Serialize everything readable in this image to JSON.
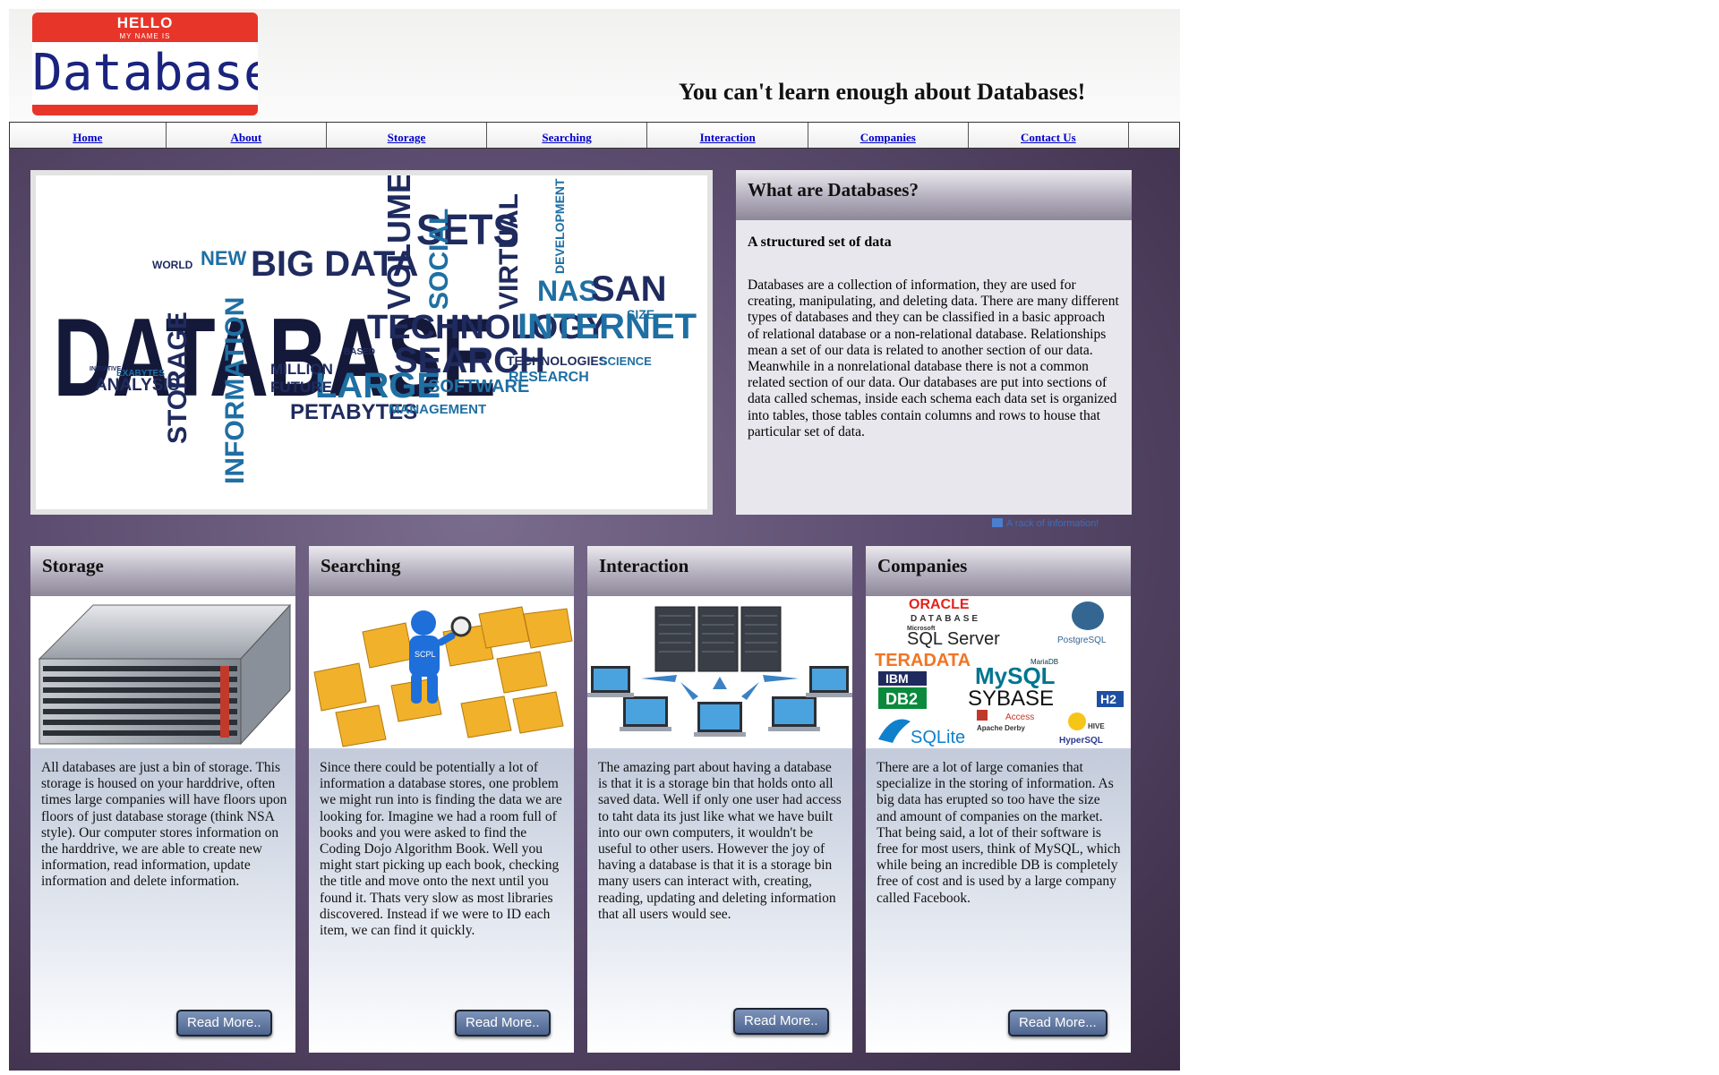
{
  "header": {
    "logo": {
      "hello": "HELLO",
      "my_name_is": "MY NAME IS",
      "name": "Database"
    },
    "tagline": "You can't learn enough about Databases!"
  },
  "nav": {
    "items": [
      {
        "label": "Home"
      },
      {
        "label": "About"
      },
      {
        "label": "Storage"
      },
      {
        "label": "Searching"
      },
      {
        "label": "Interaction"
      },
      {
        "label": "Companies"
      },
      {
        "label": "Contact Us"
      }
    ]
  },
  "hero": {
    "wordcloud": {
      "big": "DATABASE",
      "words": [
        "SETS",
        "BIG DATA",
        "VOLUME",
        "SOCIAL",
        "VIRTUAL",
        "NAS",
        "SAN",
        "NEW",
        "WORLD",
        "TECHNOLOGY",
        "INTERNET",
        "SEARCH",
        "LARGE",
        "MILLION",
        "FUTURE",
        "SOFTWARE",
        "PETABYTES",
        "MANAGEMENT",
        "ANALYSIS",
        "STORAGE",
        "INFORMATION",
        "RESEARCH",
        "TECHNOLOGIES",
        "SCIENCE",
        "EXABYTES",
        "INITIATIVE",
        "SIZE",
        "DEVELOPMENT",
        "BASED"
      ]
    }
  },
  "whatis": {
    "title": "What are Databases?",
    "subtitle": "A structured set of data",
    "body": "Databases are a collection of information, they are used for creating, manipulating, and deleting data. There are many different types of databases and they can be classified in a basic approach of relational database or a non-relational database. Relationships mean a set of our data is related to another section of our data. Meanwhile in a nonrelational database there is not a common related section of our data. Our databases are put into sections of data called schemas, inside each schema each data set is organized into tables, those tables contain columns and rows to house that particular set of data."
  },
  "credit": "A rack of information!",
  "cards": [
    {
      "title": "Storage",
      "text": "All databases are just a bin of storage. This storage is housed on your harddrive, often times large companies will have floors upon floors of just database storage (think NSA style). Our computer stores information on the harddrive, we are able to create new information, read information, update information and delete information.",
      "button": "Read More.."
    },
    {
      "title": "Searching",
      "text": "Since there could be potentially a lot of information a database stores, one problem we might run into is finding the data we are looking for. Imagine we had a room full of books and you were asked to find the Coding Dojo Algorithm Book. Well you might start picking up each book, checking the title and move onto the next until you found it. Thats very slow as most libraries discovered. Instead if we were to ID each item, we can find it quickly.",
      "button": "Read More..",
      "figure_label": "SCPL"
    },
    {
      "title": "Interaction",
      "text": "The amazing part about having a database is that it is a storage bin that holds onto all saved data. Well if only one user had access to taht data its just like what we have built into our own computers, it wouldn't be useful to other users. However the joy of having a database is that it is a storage bin many users can interact with, creating, reading, updating and deleting information that all users would see.",
      "button": "Read More.."
    },
    {
      "title": "Companies",
      "text": "There are a lot of large comanies that specialize in the storing of information. As big data has erupted so too have the size and amount of companies on the market. That being said, a lot of their software is free for most users, think of MySQL, which while being an incredible DB is completely free of cost and is used by a large company called Facebook.",
      "button": "Read More...",
      "logos": [
        "ORACLE",
        "DATABASE",
        "Microsoft",
        "SQL Server",
        "PostgreSQL",
        "TERADATA",
        "MariaDB",
        "IBM",
        "DB2",
        "MySQL",
        "SYBASE",
        "H2",
        "Access",
        "Apache Derby",
        "HIVE",
        "SQLite",
        "HyperSQL"
      ]
    }
  ],
  "colors": {
    "nav_link": "#0000cc",
    "logo_red": "#e8352a",
    "logo_navy": "#1a237e",
    "button": "#5b7299"
  }
}
